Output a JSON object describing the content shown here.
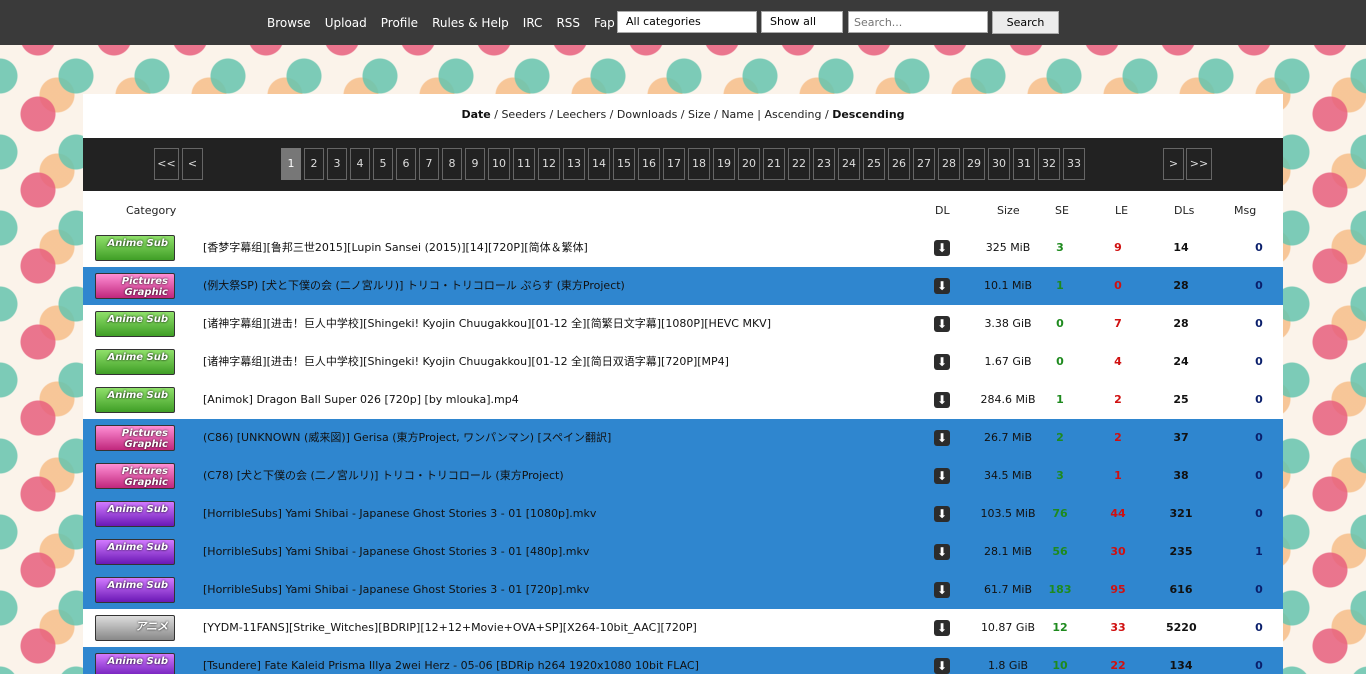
{
  "nav": [
    "Browse",
    "Upload",
    "Profile",
    "Rules & Help",
    "IRC",
    "RSS",
    "Fap"
  ],
  "filters": {
    "category": "All categories",
    "show": "Show all",
    "search_placeholder": "Search...",
    "search_button": "Search"
  },
  "sort": {
    "date": "Date",
    "seeders": "Seeders",
    "leechers": "Leechers",
    "downloads": "Downloads",
    "size": "Size",
    "name": "Name",
    "ascending": "Ascending",
    "descending": "Descending"
  },
  "pager": {
    "first": "<<",
    "prev": "<",
    "next": ">",
    "last": ">>",
    "pages": [
      "1",
      "2",
      "3",
      "4",
      "5",
      "6",
      "7",
      "8",
      "9",
      "10",
      "11",
      "12",
      "13",
      "14",
      "15",
      "16",
      "17",
      "18",
      "19",
      "20",
      "21",
      "22",
      "23",
      "24",
      "25",
      "26",
      "27",
      "28",
      "29",
      "30",
      "31",
      "32",
      "33"
    ],
    "current": "1"
  },
  "headers": {
    "category": "Category",
    "dl": "DL",
    "size": "Size",
    "se": "SE",
    "le": "LE",
    "dls": "DLs",
    "msg": "Msg"
  },
  "rows": [
    {
      "cat": "Anime Sub",
      "cat_style": "anime-green",
      "title": "[香梦字幕组][鲁邦三世2015][Lupin Sansei (2015)][14][720P][简体＆繁体]",
      "size": "325 MiB",
      "se": "3",
      "le": "9",
      "dls": "14",
      "msg": "0",
      "bg": "white"
    },
    {
      "cat": "Pictures Graphic",
      "cat_style": "pictures",
      "title": "(例大祭SP) [犬と下僕の会 (二ノ宮ルリ)] トリコ・トリコロール ぷらす (東方Project)",
      "size": "10.1 MiB",
      "se": "1",
      "le": "0",
      "dls": "28",
      "msg": "0",
      "bg": "blue"
    },
    {
      "cat": "Anime Sub",
      "cat_style": "anime-green",
      "title": "[诸神字幕组][进击！巨人中学校][Shingeki! Kyojin Chuugakkou][01-12 全][简繁日文字幕][1080P][HEVC MKV]",
      "size": "3.38 GiB",
      "se": "0",
      "le": "7",
      "dls": "28",
      "msg": "0",
      "bg": "white"
    },
    {
      "cat": "Anime Sub",
      "cat_style": "anime-green",
      "title": "[诸神字幕组][进击！巨人中学校][Shingeki! Kyojin Chuugakkou][01-12 全][简日双语字幕][720P][MP4]",
      "size": "1.67 GiB",
      "se": "0",
      "le": "4",
      "dls": "24",
      "msg": "0",
      "bg": "white"
    },
    {
      "cat": "Anime Sub",
      "cat_style": "anime-green",
      "title": "[Animok] Dragon Ball Super 026 [720p] [by mlouka].mp4",
      "size": "284.6 MiB",
      "se": "1",
      "le": "2",
      "dls": "25",
      "msg": "0",
      "bg": "white"
    },
    {
      "cat": "Pictures Graphic",
      "cat_style": "pictures",
      "title": "(C86) [UNKNOWN (威来図)] Gerisa (東方Project, ワンパンマン) [スペイン翻訳]",
      "size": "26.7 MiB",
      "se": "2",
      "le": "2",
      "dls": "37",
      "msg": "0",
      "bg": "blue"
    },
    {
      "cat": "Pictures Graphic",
      "cat_style": "pictures",
      "title": "(C78) [犬と下僕の会 (二ノ宮ルリ)] トリコ・トリコロール (東方Project)",
      "size": "34.5 MiB",
      "se": "3",
      "le": "1",
      "dls": "38",
      "msg": "0",
      "bg": "blue"
    },
    {
      "cat": "Anime Sub",
      "cat_style": "anime-purple",
      "title": "[HorribleSubs] Yami Shibai - Japanese Ghost Stories 3 - 01 [1080p].mkv",
      "size": "103.5 MiB",
      "se": "76",
      "le": "44",
      "dls": "321",
      "msg": "0",
      "bg": "blue"
    },
    {
      "cat": "Anime Sub",
      "cat_style": "anime-purple",
      "title": "[HorribleSubs] Yami Shibai - Japanese Ghost Stories 3 - 01 [480p].mkv",
      "size": "28.1 MiB",
      "se": "56",
      "le": "30",
      "dls": "235",
      "msg": "1",
      "bg": "blue"
    },
    {
      "cat": "Anime Sub",
      "cat_style": "anime-purple",
      "title": "[HorribleSubs] Yami Shibai - Japanese Ghost Stories 3 - 01 [720p].mkv",
      "size": "61.7 MiB",
      "se": "183",
      "le": "95",
      "dls": "616",
      "msg": "0",
      "bg": "blue"
    },
    {
      "cat": "アニメ",
      "cat_style": "anime-jp",
      "title": "[YYDM-11FANS][Strike_Witches][BDRIP][12+12+Movie+OVA+SP][X264-10bit_AAC][720P]",
      "size": "10.87 GiB",
      "se": "12",
      "le": "33",
      "dls": "5220",
      "msg": "0",
      "bg": "white"
    },
    {
      "cat": "Anime Sub",
      "cat_style": "anime-purple",
      "title": "[Tsundere] Fate Kaleid Prisma Illya 2wei Herz - 05-06 [BDRip h264 1920x1080 10bit FLAC]",
      "size": "1.8 GiB",
      "se": "10",
      "le": "22",
      "dls": "134",
      "msg": "0",
      "bg": "blue"
    }
  ]
}
